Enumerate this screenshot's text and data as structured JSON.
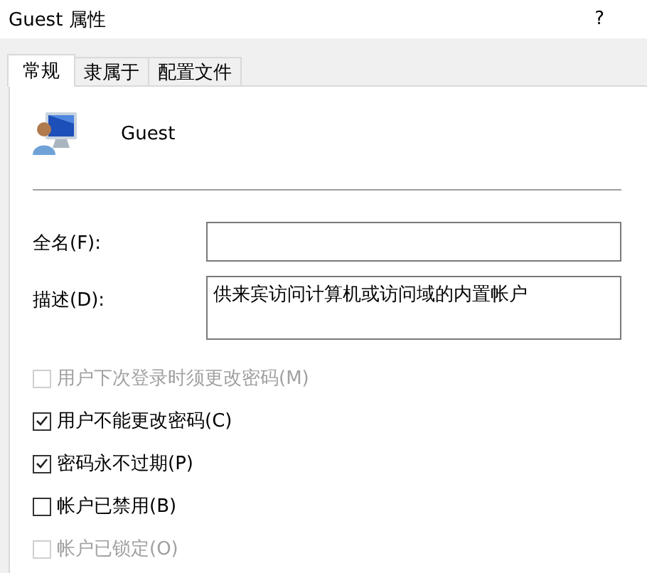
{
  "window": {
    "title": "Guest 属性",
    "help": "?"
  },
  "tabs": [
    {
      "label": "常规",
      "selected": true
    },
    {
      "label": "隶属于",
      "selected": false
    },
    {
      "label": "配置文件",
      "selected": false
    }
  ],
  "account": {
    "name": "Guest"
  },
  "fields": [
    {
      "label": "全名(F):",
      "kind": "line"
    },
    {
      "label": "描述(D):",
      "kind": "area",
      "value": "供来宾访问计算机或访问域的内置帐户"
    }
  ],
  "options": [
    {
      "label": "用户下次登录时须更改密码(M)",
      "checked": false,
      "disabled": true
    },
    {
      "label": "用户不能更改密码(C)",
      "checked": true,
      "disabled": false
    },
    {
      "label": "密码永不过期(P)",
      "checked": true,
      "disabled": false
    },
    {
      "label": "帐户已禁用(B)",
      "checked": false,
      "disabled": false
    },
    {
      "label": "帐户已锁定(O)",
      "checked": false,
      "disabled": true
    }
  ]
}
